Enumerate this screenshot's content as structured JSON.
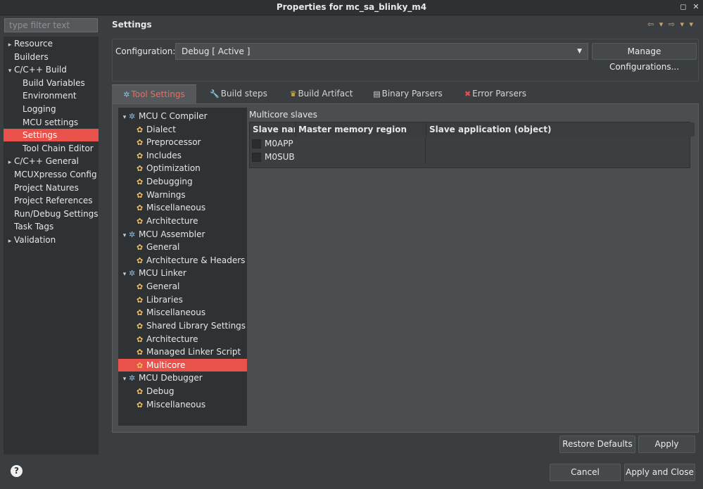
{
  "window": {
    "title": "Properties for mc_sa_blinky_m4"
  },
  "filter": {
    "placeholder": "type filter text"
  },
  "leftnav": {
    "items": [
      {
        "label": "Resource",
        "expand": "▸"
      },
      {
        "label": "Builders",
        "expand": ""
      },
      {
        "label": "C/C++ Build",
        "expand": "▾"
      },
      {
        "label": "Build Variables",
        "expand": ""
      },
      {
        "label": "Environment",
        "expand": ""
      },
      {
        "label": "Logging",
        "expand": ""
      },
      {
        "label": "MCU settings",
        "expand": ""
      },
      {
        "label": "Settings",
        "expand": "",
        "selected": true
      },
      {
        "label": "Tool Chain Editor",
        "expand": ""
      },
      {
        "label": "C/C++ General",
        "expand": "▸"
      },
      {
        "label": "MCUXpresso Config Tools",
        "expand": ""
      },
      {
        "label": "Project Natures",
        "expand": ""
      },
      {
        "label": "Project References",
        "expand": ""
      },
      {
        "label": "Run/Debug Settings",
        "expand": ""
      },
      {
        "label": "Task Tags",
        "expand": ""
      },
      {
        "label": "Validation",
        "expand": "▸"
      }
    ]
  },
  "header": {
    "title": "Settings"
  },
  "configuration": {
    "label": "Configuration:",
    "value": "Debug  [ Active ]",
    "manage_label": "Manage Configurations..."
  },
  "tabs": [
    {
      "label": "Tool Settings",
      "icon": "gear-icon",
      "active": true
    },
    {
      "label": "Build steps",
      "icon": "wrench-icon"
    },
    {
      "label": "Build Artifact",
      "icon": "trophy-icon"
    },
    {
      "label": "Binary Parsers",
      "icon": "binary-icon"
    },
    {
      "label": "Error Parsers",
      "icon": "error-icon"
    }
  ],
  "tree": {
    "items": [
      {
        "label": "MCU C Compiler",
        "level": 0
      },
      {
        "label": "Dialect",
        "level": 1
      },
      {
        "label": "Preprocessor",
        "level": 1
      },
      {
        "label": "Includes",
        "level": 1
      },
      {
        "label": "Optimization",
        "level": 1
      },
      {
        "label": "Debugging",
        "level": 1
      },
      {
        "label": "Warnings",
        "level": 1
      },
      {
        "label": "Miscellaneous",
        "level": 1
      },
      {
        "label": "Architecture",
        "level": 1
      },
      {
        "label": "MCU Assembler",
        "level": 0
      },
      {
        "label": "General",
        "level": 1
      },
      {
        "label": "Architecture & Headers",
        "level": 1
      },
      {
        "label": "MCU Linker",
        "level": 0
      },
      {
        "label": "General",
        "level": 1
      },
      {
        "label": "Libraries",
        "level": 1
      },
      {
        "label": "Miscellaneous",
        "level": 1
      },
      {
        "label": "Shared Library Settings",
        "level": 1
      },
      {
        "label": "Architecture",
        "level": 1
      },
      {
        "label": "Managed Linker Script",
        "level": 1
      },
      {
        "label": "Multicore",
        "level": 1,
        "selected": true
      },
      {
        "label": "MCU Debugger",
        "level": 0
      },
      {
        "label": "Debug",
        "level": 1
      },
      {
        "label": "Miscellaneous",
        "level": 1
      }
    ]
  },
  "multicore": {
    "title": "Multicore slaves",
    "columns": [
      "Slave name",
      "Master memory region",
      "Slave application (object)"
    ],
    "rows": [
      {
        "name": "M0APP",
        "region": "",
        "app": ""
      },
      {
        "name": "M0SUB",
        "region": "",
        "app": ""
      }
    ]
  },
  "buttons": {
    "restore_defaults": "Restore Defaults",
    "apply": "Apply",
    "cancel": "Cancel",
    "apply_and_close": "Apply and Close"
  },
  "help": {
    "glyph": "?"
  },
  "nav_arrows": "⇦ ▾ ⇨ ▾ ▾"
}
